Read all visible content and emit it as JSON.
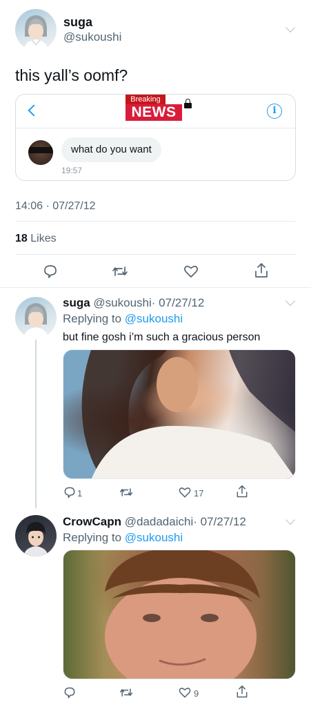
{
  "main_tweet": {
    "name": "suga",
    "handle": "@sukoushi",
    "text": "this yall’s oomf?",
    "timestamp": "14:06 · 07/27/12",
    "likes_count": "18",
    "likes_label": "Likes"
  },
  "embedded_dm": {
    "breaking_label": "Breaking",
    "news_label": "NEWS",
    "message": "what do you want",
    "time": "19:57"
  },
  "replies": [
    {
      "name": "suga",
      "handle": "@sukoushi",
      "date": "· 07/27/12",
      "replying_prefix": "Replying to",
      "replying_to": "@sukoushi",
      "text": "but fine gosh i’m such a gracious person",
      "reply_count": "1",
      "like_count": "17"
    },
    {
      "name": "CrowCapn",
      "handle": "@dadadaichi",
      "date": "· 07/27/12",
      "replying_prefix": "Replying to",
      "replying_to": "@sukoushi",
      "like_count": "9"
    }
  ],
  "colors": {
    "accent": "#1d9bf0",
    "text_secondary": "#536471",
    "news_red": "#d81d3a"
  },
  "icons": [
    "chevron-down-icon",
    "back-chevron-icon",
    "info-icon",
    "lock-icon",
    "reply-icon",
    "retweet-icon",
    "like-icon",
    "share-icon"
  ]
}
